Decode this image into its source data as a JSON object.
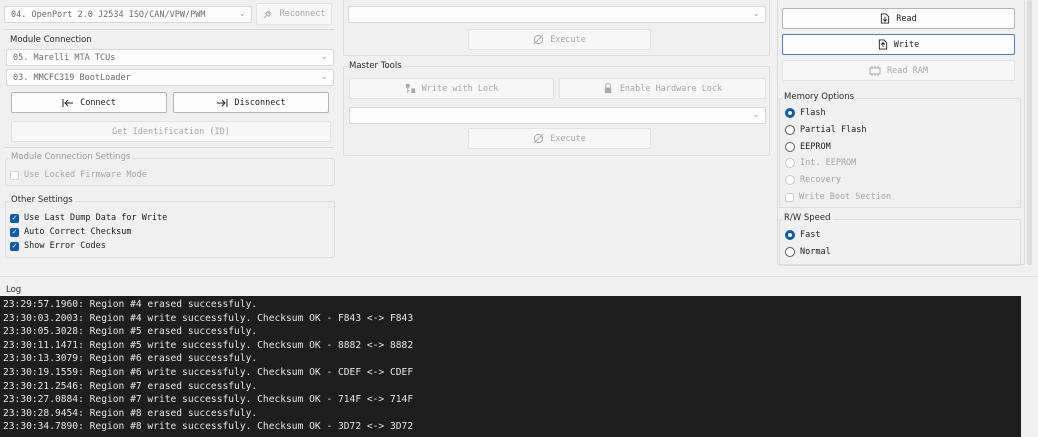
{
  "device": {
    "interface_value": "04. OpenPort 2.0 J2534 ISO/CAN/VPW/PWM",
    "reconnect_label": "Reconnect"
  },
  "module_connection": {
    "title": "Module Connection",
    "module_value": "05. Marelli MTA TCUs",
    "bootloader_value": "03. MMCFC319 BootLoader",
    "connect_label": "Connect",
    "disconnect_label": "Disconnect",
    "get_id_label": "Get Identification (ID)"
  },
  "module_connection_settings": {
    "title": "Module Connection Settings",
    "locked_firmware_label": "Use Locked Firmware Mode",
    "locked_firmware_checked": false
  },
  "other_settings": {
    "title": "Other Settings",
    "items": [
      {
        "label": "Use Last Dump Data for Write",
        "checked": true
      },
      {
        "label": "Auto Correct Checksum",
        "checked": true
      },
      {
        "label": "Show Error Codes",
        "checked": true
      }
    ]
  },
  "center": {
    "top_select_value": "",
    "execute_label": "Execute"
  },
  "master_tools": {
    "title": "Master Tools",
    "write_with_lock_label": "Write with Lock",
    "enable_hw_lock_label": "Enable Hardware Lock",
    "select_value": "",
    "execute_label": "Execute"
  },
  "actions": {
    "read_label": "Read",
    "write_label": "Write",
    "read_ram_label": "Read RAM"
  },
  "memory_options": {
    "title": "Memory Options",
    "flash_label": "Flash",
    "partial_flash_label": "Partial Flash",
    "eeprom_label": "EEPROM",
    "int_eeprom_label": "Int. EEPROM",
    "recovery_label": "Recovery",
    "write_boot_label": "Write Boot Section",
    "selected": "Flash"
  },
  "rw_speed": {
    "title": "R/W Speed",
    "fast_label": "Fast",
    "normal_label": "Normal",
    "selected": "Fast"
  },
  "log": {
    "title": "Log",
    "lines": [
      "23:29:57.1960: Region #4 erased successfuly.",
      "23:30:03.2003: Region #4 write successfuly. Checksum OK - F843 <-> F843",
      "23:30:05.3028: Region #5 erased successfuly.",
      "23:30:11.1471: Region #5 write successfuly. Checksum OK - 8882 <-> 8882",
      "23:30:13.3079: Region #6 erased successfuly.",
      "23:30:19.1559: Region #6 write successfuly. Checksum OK - CDEF <-> CDEF",
      "23:30:21.2546: Region #7 erased successfuly.",
      "23:30:27.0884: Region #7 write successfuly. Checksum OK - 714F <-> 714F",
      "23:30:28.9454: Region #8 erased successfuly.",
      "23:30:34.7890: Region #8 write successfuly. Checksum OK - 3D72 <-> 3D72"
    ]
  },
  "colors": {
    "accent": "#0b5cad",
    "log_background": "#1e1e1e",
    "log_text": "#e6e6e6"
  }
}
